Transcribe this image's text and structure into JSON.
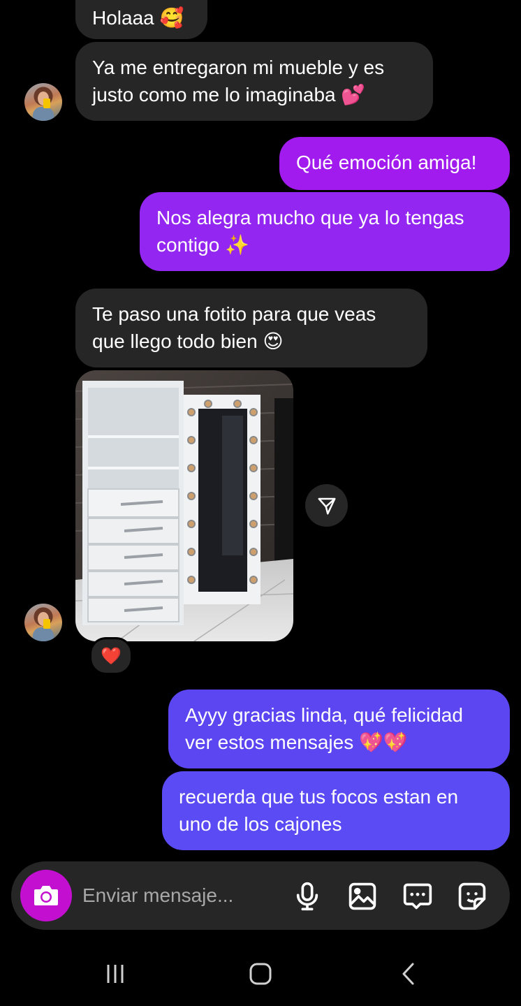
{
  "messages": [
    {
      "text": "Holaaa 🥰",
      "from": "contact"
    },
    {
      "text": "Ya me entregaron mi mueble y es\njusto como me lo imaginaba 💕",
      "from": "contact"
    },
    {
      "text": "Qué emoción amiga!",
      "from": "me"
    },
    {
      "text": "Nos alegra mucho que ya lo tengas\ncontigo ✨",
      "from": "me"
    },
    {
      "text": "Te paso una fotito para que veas\nque llego todo bien 😍",
      "from": "contact"
    },
    {
      "text": "Ayyy gracias linda, qué felicidad\nver estos mensajes 💖💖",
      "from": "me"
    },
    {
      "text": "recuerda que tus focos estan en\nuno de los cajones",
      "from": "me"
    }
  ],
  "photo": {
    "description_icon": "furniture-photo"
  },
  "reaction": "❤️",
  "composer": {
    "placeholder": "Enviar mensaje..."
  },
  "colors": {
    "incoming_bubble": "#262626",
    "outgoing_purple": "#9a1ff0",
    "outgoing_blue": "#5b4af3",
    "camera_button": "#c30fd0",
    "background": "#000000"
  },
  "icons": [
    "camera-icon",
    "microphone-icon",
    "gallery-icon",
    "chat-more-icon",
    "sticker-icon",
    "share-icon",
    "recent-apps-icon",
    "home-icon",
    "back-icon"
  ]
}
